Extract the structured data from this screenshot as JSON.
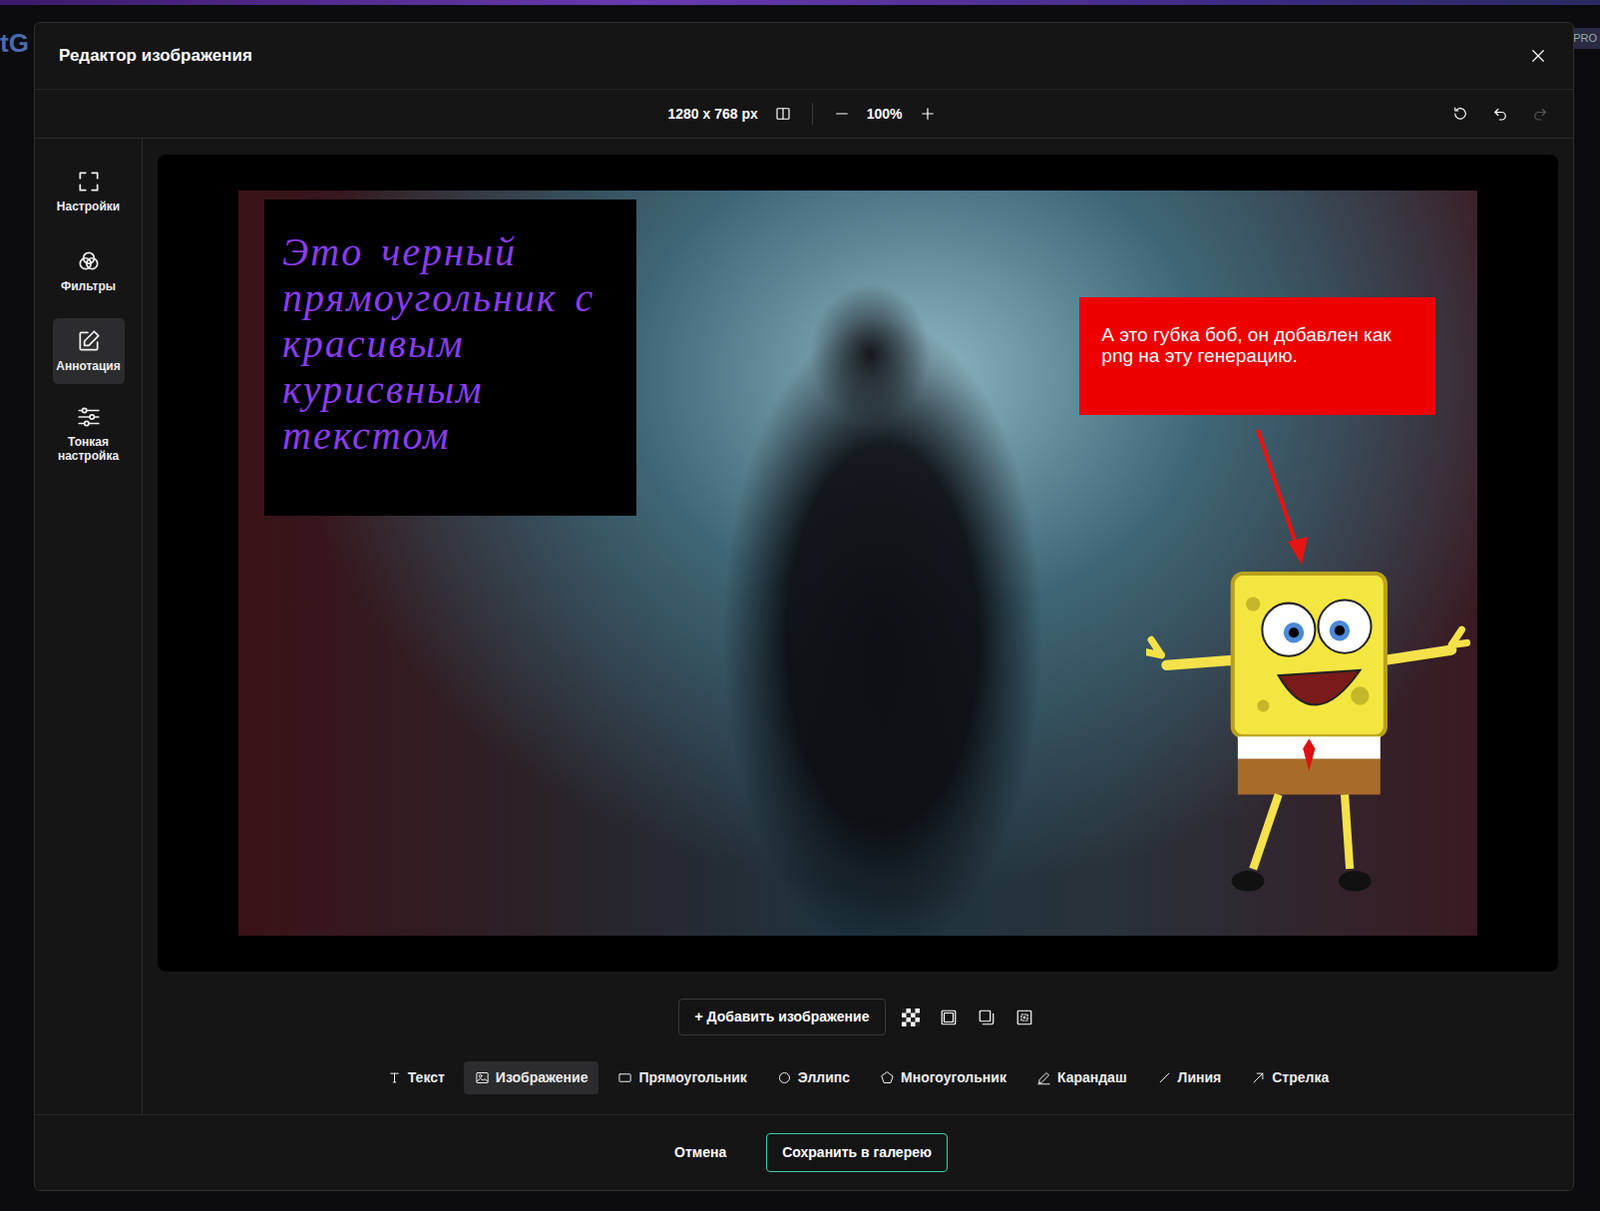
{
  "background": {
    "logo_fragment": "tG",
    "badge": "PRO"
  },
  "window": {
    "title": "Редактор изображения"
  },
  "toolbar": {
    "size": "1280 x 768 px",
    "zoom": "100%",
    "redo_disabled": true
  },
  "sidebar": {
    "items": [
      {
        "label": "Настройки",
        "selected": false
      },
      {
        "label": "Фильтры",
        "selected": false
      },
      {
        "label": "Аннотация",
        "selected": true
      },
      {
        "label": "Тонкая настройка",
        "selected": false
      }
    ]
  },
  "canvas": {
    "annotations": [
      {
        "kind": "textbox",
        "text": "Это черный прямоугольник с красивым курисвным текстом",
        "color": "#000000"
      },
      {
        "kind": "callout",
        "text": "А это губка боб, он добавлен как png на эту генерацию.",
        "color": "#ee0000"
      },
      {
        "kind": "arrow",
        "color": "#e81414"
      },
      {
        "kind": "image"
      }
    ]
  },
  "image_actions": {
    "add_label": "+ Добавить изображение"
  },
  "tools": [
    {
      "label": "Текст",
      "selected": false
    },
    {
      "label": "Изображение",
      "selected": true
    },
    {
      "label": "Прямоугольник",
      "selected": false
    },
    {
      "label": "Эллипс",
      "selected": false
    },
    {
      "label": "Многоугольник",
      "selected": false
    },
    {
      "label": "Карандаш",
      "selected": false
    },
    {
      "label": "Линия",
      "selected": false
    },
    {
      "label": "Стрелка",
      "selected": false
    }
  ],
  "footer": {
    "buttons": [
      {
        "label": "Отмена",
        "kind": "plain"
      },
      {
        "label": "Сохранить в галерею",
        "kind": "primary"
      }
    ]
  }
}
